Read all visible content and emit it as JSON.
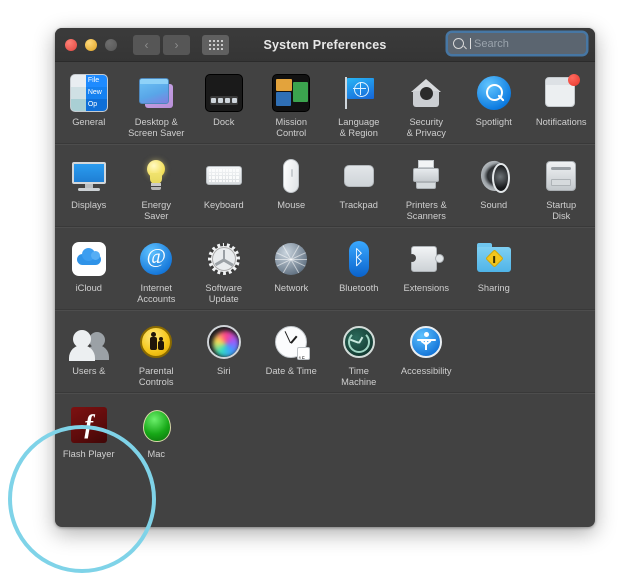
{
  "window": {
    "title": "System Preferences",
    "traffic_lights": [
      "close",
      "minimize",
      "zoom-disabled"
    ],
    "nav": {
      "back": "‹",
      "forward": "›",
      "show_all": "show-all-grid"
    },
    "search": {
      "placeholder": "Search",
      "value": ""
    }
  },
  "rows": [
    {
      "panes": [
        {
          "name": "general",
          "label": "General",
          "icon": "general-icon"
        },
        {
          "name": "desktop-screen-saver",
          "label": "Desktop &\nScreen Saver",
          "icon": "desktop-icon"
        },
        {
          "name": "dock",
          "label": "Dock",
          "icon": "dock-icon"
        },
        {
          "name": "mission-control",
          "label": "Mission\nControl",
          "icon": "mission-control-icon"
        },
        {
          "name": "language-region",
          "label": "Language\n& Region",
          "icon": "flag-globe-icon"
        },
        {
          "name": "security-privacy",
          "label": "Security\n& Privacy",
          "icon": "house-lock-icon"
        },
        {
          "name": "spotlight",
          "label": "Spotlight",
          "icon": "magnifier-icon"
        },
        {
          "name": "notifications",
          "label": "Notifications",
          "icon": "notification-badge-icon"
        }
      ]
    },
    {
      "panes": [
        {
          "name": "displays",
          "label": "Displays",
          "icon": "monitor-icon"
        },
        {
          "name": "energy-saver",
          "label": "Energy\nSaver",
          "icon": "lightbulb-icon"
        },
        {
          "name": "keyboard",
          "label": "Keyboard",
          "icon": "keyboard-icon"
        },
        {
          "name": "mouse",
          "label": "Mouse",
          "icon": "mouse-icon"
        },
        {
          "name": "trackpad",
          "label": "Trackpad",
          "icon": "trackpad-icon"
        },
        {
          "name": "printers-scanners",
          "label": "Printers &\nScanners",
          "icon": "printer-icon"
        },
        {
          "name": "sound",
          "label": "Sound",
          "icon": "speaker-icon"
        },
        {
          "name": "startup-disk",
          "label": "Startup\nDisk",
          "icon": "disk-drive-icon"
        }
      ]
    },
    {
      "panes": [
        {
          "name": "icloud",
          "label": "iCloud",
          "icon": "cloud-icon"
        },
        {
          "name": "internet-accounts",
          "label": "Internet\nAccounts",
          "icon": "at-sign-icon"
        },
        {
          "name": "software-update",
          "label": "Software\nUpdate",
          "icon": "gear-fan-icon"
        },
        {
          "name": "network",
          "label": "Network",
          "icon": "globe-mesh-icon"
        },
        {
          "name": "bluetooth",
          "label": "Bluetooth",
          "icon": "bluetooth-icon"
        },
        {
          "name": "extensions",
          "label": "Extensions",
          "icon": "puzzle-piece-icon"
        },
        {
          "name": "sharing",
          "label": "Sharing",
          "icon": "folder-sign-icon"
        }
      ]
    },
    {
      "panes": [
        {
          "name": "users-groups",
          "label": "Users &",
          "icon": "people-icon"
        },
        {
          "name": "parental-controls",
          "label": "Parental\nControls",
          "icon": "parental-coin-icon"
        },
        {
          "name": "siri",
          "label": "Siri",
          "icon": "siri-swirl-icon"
        },
        {
          "name": "date-time",
          "label": "Date & Time",
          "icon": "clock-calendar-icon"
        },
        {
          "name": "time-machine",
          "label": "Time\nMachine",
          "icon": "time-machine-icon"
        },
        {
          "name": "accessibility",
          "label": "Accessibility",
          "icon": "accessibility-icon"
        }
      ]
    },
    {
      "panes": [
        {
          "name": "flash-player",
          "label": "Flash Player",
          "icon": "flash-player-icon"
        },
        {
          "name": "green-utility",
          "label": "Mac",
          "icon": "green-app-icon"
        }
      ]
    }
  ],
  "highlight": {
    "target": "flash-player",
    "color": "#7fd3e8"
  }
}
